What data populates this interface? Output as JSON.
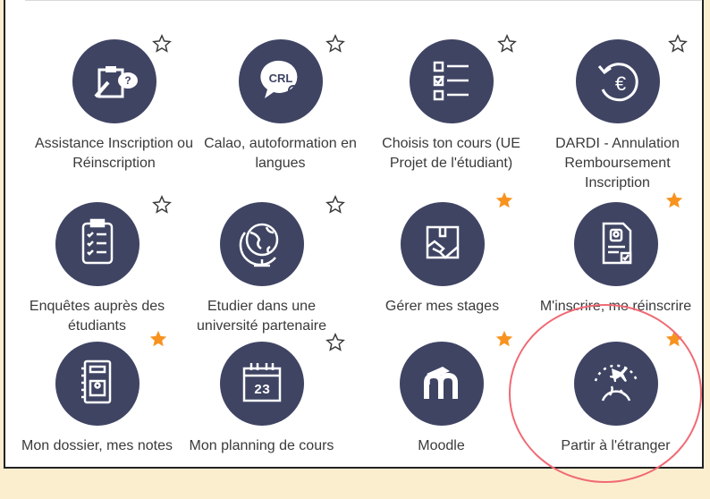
{
  "colors": {
    "background": "#fbeecf",
    "icon_circle": "#3f4463",
    "star_favorite": "#f7931e",
    "star_outline": "#3a3a3a",
    "highlight": "#f06a74"
  },
  "tiles": [
    {
      "label": "Assistance Inscription ou Réinscription",
      "icon": "clipboard-question-icon",
      "favorite": false
    },
    {
      "label": "Calao, autoformation en langues",
      "icon": "crl-chat-bubble-icon",
      "favorite": false
    },
    {
      "label": "Choisis ton cours (UE Projet de l'étudiant)",
      "icon": "checklist-icon",
      "favorite": false
    },
    {
      "label": "DARDI - Annulation Remboursement Inscription",
      "icon": "euro-refund-icon",
      "favorite": false
    },
    {
      "label": "Enquêtes auprès des étudiants",
      "icon": "survey-clipboard-icon",
      "favorite": false
    },
    {
      "label": "Etudier dans une université partenaire",
      "icon": "globe-icon",
      "favorite": false
    },
    {
      "label": "Gérer mes stages",
      "icon": "handshake-box-icon",
      "favorite": true
    },
    {
      "label": "M'inscrire, me réinscrire",
      "icon": "registration-form-icon",
      "favorite": true
    },
    {
      "label": "Mon dossier, mes notes",
      "icon": "notebook-icon",
      "favorite": true
    },
    {
      "label": "Mon planning de cours",
      "icon": "calendar-icon",
      "favorite": false
    },
    {
      "label": "Moodle",
      "icon": "moodle-icon",
      "favorite": true
    },
    {
      "label": "Partir à l'étranger",
      "icon": "plane-globe-icon",
      "favorite": true
    }
  ],
  "icon_text": {
    "crl": "CRL",
    "calendar_day": "23"
  }
}
